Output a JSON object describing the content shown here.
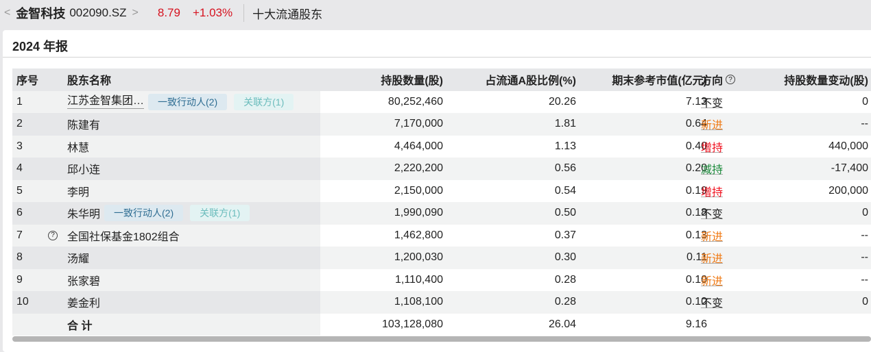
{
  "header": {
    "company": "金智科技",
    "code": "002090.SZ",
    "price": "8.79",
    "change_pct": "+1.03%",
    "section": "十大流通股东"
  },
  "period": "2024 年报",
  "columns": {
    "no": "序号",
    "name": "股东名称",
    "holding": "持股数量(股)",
    "ratio": "占流通A股比例(%)",
    "value": "期末参考市值(亿元)",
    "direction": "方向",
    "change": "持股数量变动(股)"
  },
  "colors": {
    "up": "#f0101e",
    "new": "#f07a14",
    "down": "#1a8a3a",
    "same": "#222222"
  },
  "rows": [
    {
      "no": "1",
      "name": "江苏金智集团…",
      "tag1": "一致行动人(2)",
      "tag2": "关联方(1)",
      "holding": "80,252,460",
      "ratio": "20.26",
      "value": "7.13",
      "direction": "不变",
      "dir_type": "same",
      "change": "0"
    },
    {
      "no": "2",
      "name": "陈建有",
      "holding": "7,170,000",
      "ratio": "1.81",
      "value": "0.64",
      "direction": "新进",
      "dir_type": "new",
      "change": "--"
    },
    {
      "no": "3",
      "name": "林慧",
      "holding": "4,464,000",
      "ratio": "1.13",
      "value": "0.40",
      "direction": "增持",
      "dir_type": "up",
      "change": "440,000"
    },
    {
      "no": "4",
      "name": "邱小连",
      "holding": "2,220,200",
      "ratio": "0.56",
      "value": "0.20",
      "direction": "减持",
      "dir_type": "down",
      "change": "-17,400"
    },
    {
      "no": "5",
      "name": "李明",
      "holding": "2,150,000",
      "ratio": "0.54",
      "value": "0.19",
      "direction": "增持",
      "dir_type": "up",
      "change": "200,000"
    },
    {
      "no": "6",
      "name": "朱华明",
      "tag1": "一致行动人(2)",
      "tag2": "关联方(1)",
      "holding": "1,990,090",
      "ratio": "0.50",
      "value": "0.18",
      "direction": "不变",
      "dir_type": "same",
      "change": "0"
    },
    {
      "no": "7",
      "name": "全国社保基金1802组合",
      "help": true,
      "holding": "1,462,800",
      "ratio": "0.37",
      "value": "0.13",
      "direction": "新进",
      "dir_type": "new",
      "change": "--"
    },
    {
      "no": "8",
      "name": "汤耀",
      "holding": "1,200,030",
      "ratio": "0.30",
      "value": "0.11",
      "direction": "新进",
      "dir_type": "new",
      "change": "--"
    },
    {
      "no": "9",
      "name": "张家碧",
      "holding": "1,110,400",
      "ratio": "0.28",
      "value": "0.10",
      "direction": "新进",
      "dir_type": "new",
      "change": "--"
    },
    {
      "no": "10",
      "name": "姜金利",
      "holding": "1,108,100",
      "ratio": "0.28",
      "value": "0.10",
      "direction": "不变",
      "dir_type": "same",
      "change": "0"
    }
  ],
  "total": {
    "label": "合 计",
    "holding": "103,128,080",
    "ratio": "26.04",
    "value": "9.16"
  }
}
